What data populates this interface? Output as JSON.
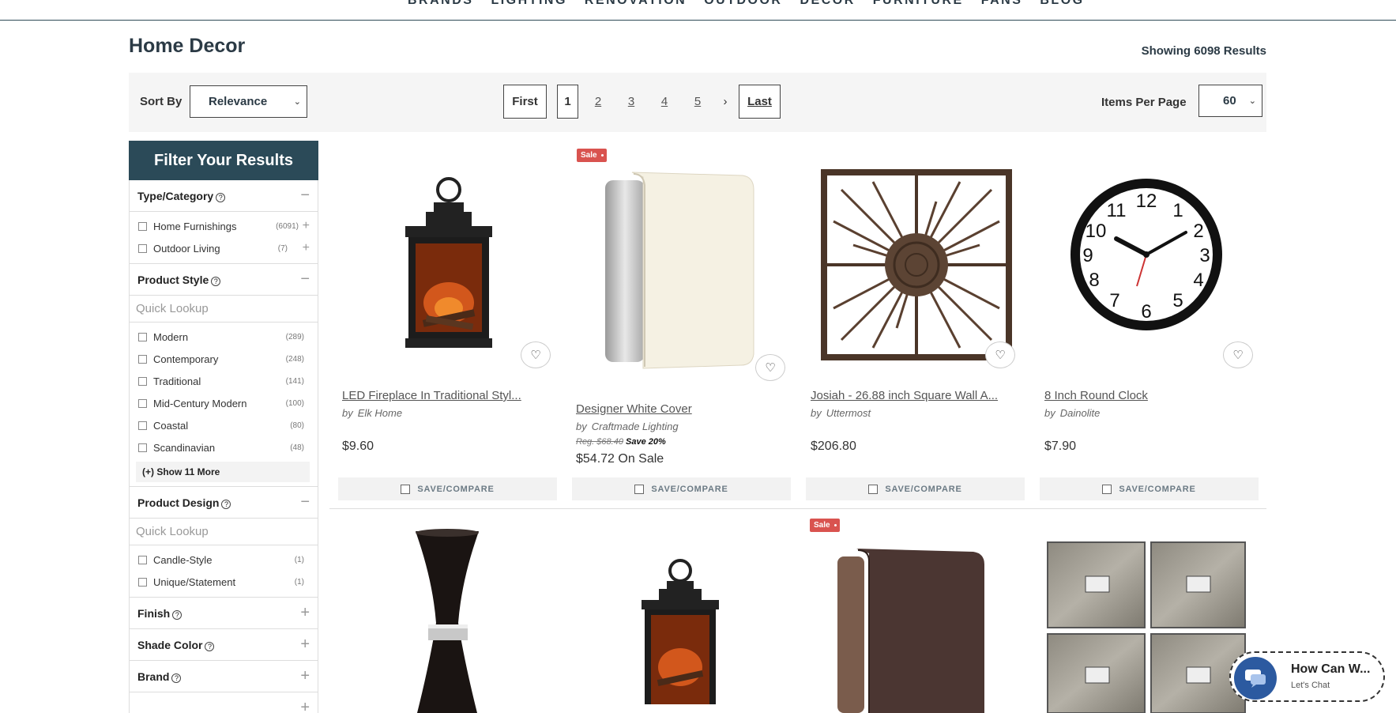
{
  "nav": {
    "items": [
      "BRANDS",
      "LIGHTING",
      "RENOVATION",
      "OUTDOOR",
      "DECOR",
      "FURNITURE",
      "FANS",
      "BLOG"
    ]
  },
  "page": {
    "title": "Home Decor",
    "results": "Showing 6098 Results"
  },
  "toolbar": {
    "sort_label": "Sort By",
    "sort_value": "Relevance",
    "first": "First",
    "current_page": "1",
    "pages": [
      "2",
      "3",
      "4",
      "5"
    ],
    "next": "›",
    "last": "Last",
    "ipp_label": "Items Per Page",
    "ipp_value": "60"
  },
  "sidebar": {
    "title": "Filter Your Results",
    "type_category": {
      "label": "Type/Category",
      "toggle": "−",
      "options": [
        {
          "label": "Home Furnishings",
          "count": "(6091)"
        },
        {
          "label": "Outdoor Living",
          "count": "(7)"
        }
      ]
    },
    "product_style": {
      "label": "Product Style",
      "toggle": "−",
      "lookup": "Quick Lookup",
      "options": [
        {
          "label": "Modern",
          "count": "(289)"
        },
        {
          "label": "Contemporary",
          "count": "(248)"
        },
        {
          "label": "Traditional",
          "count": "(141)"
        },
        {
          "label": "Mid-Century Modern",
          "count": "(100)"
        },
        {
          "label": "Coastal",
          "count": "(80)"
        },
        {
          "label": "Scandinavian",
          "count": "(48)"
        }
      ],
      "show_more": "(+) Show 11 More"
    },
    "product_design": {
      "label": "Product Design",
      "toggle": "−",
      "lookup": "Quick Lookup",
      "options": [
        {
          "label": "Candle-Style",
          "count": "(1)"
        },
        {
          "label": "Unique/Statement",
          "count": "(1)"
        }
      ]
    },
    "finish": {
      "label": "Finish",
      "toggle": "+"
    },
    "shade_color": {
      "label": "Shade Color",
      "toggle": "+"
    },
    "brand": {
      "label": "Brand",
      "toggle": "+"
    }
  },
  "products": [
    {
      "name": "LED Fireplace In Traditional Styl...",
      "by": "by",
      "brand": "Elk Home",
      "price": "$9.60",
      "compare": "SAVE/COMPARE"
    },
    {
      "sale": "Sale",
      "name": "Designer White Cover",
      "by": "by",
      "brand": "Craftmade Lighting",
      "reg": "Reg. $68.40",
      "save": "Save 20%",
      "price": "$54.72 On Sale",
      "compare": "SAVE/COMPARE"
    },
    {
      "name": "Josiah - 26.88 inch Square Wall A...",
      "by": "by",
      "brand": "Uttermost",
      "price": "$206.80",
      "compare": "SAVE/COMPARE"
    },
    {
      "name": "8 Inch Round Clock",
      "by": "by",
      "brand": "Dainolite",
      "price": "$7.90",
      "compare": "SAVE/COMPARE"
    }
  ],
  "row2": {
    "sale": "Sale"
  },
  "clock_numerals": [
    "12",
    "1",
    "2",
    "3",
    "4",
    "5",
    "6",
    "7",
    "8",
    "9",
    "10",
    "11"
  ],
  "chat": {
    "title": "How Can W...",
    "subtitle": "Let's Chat"
  },
  "icons": {
    "wishlist": "heart-icon",
    "help": "question-circle-icon",
    "chat": "chat-bubble-icon"
  }
}
